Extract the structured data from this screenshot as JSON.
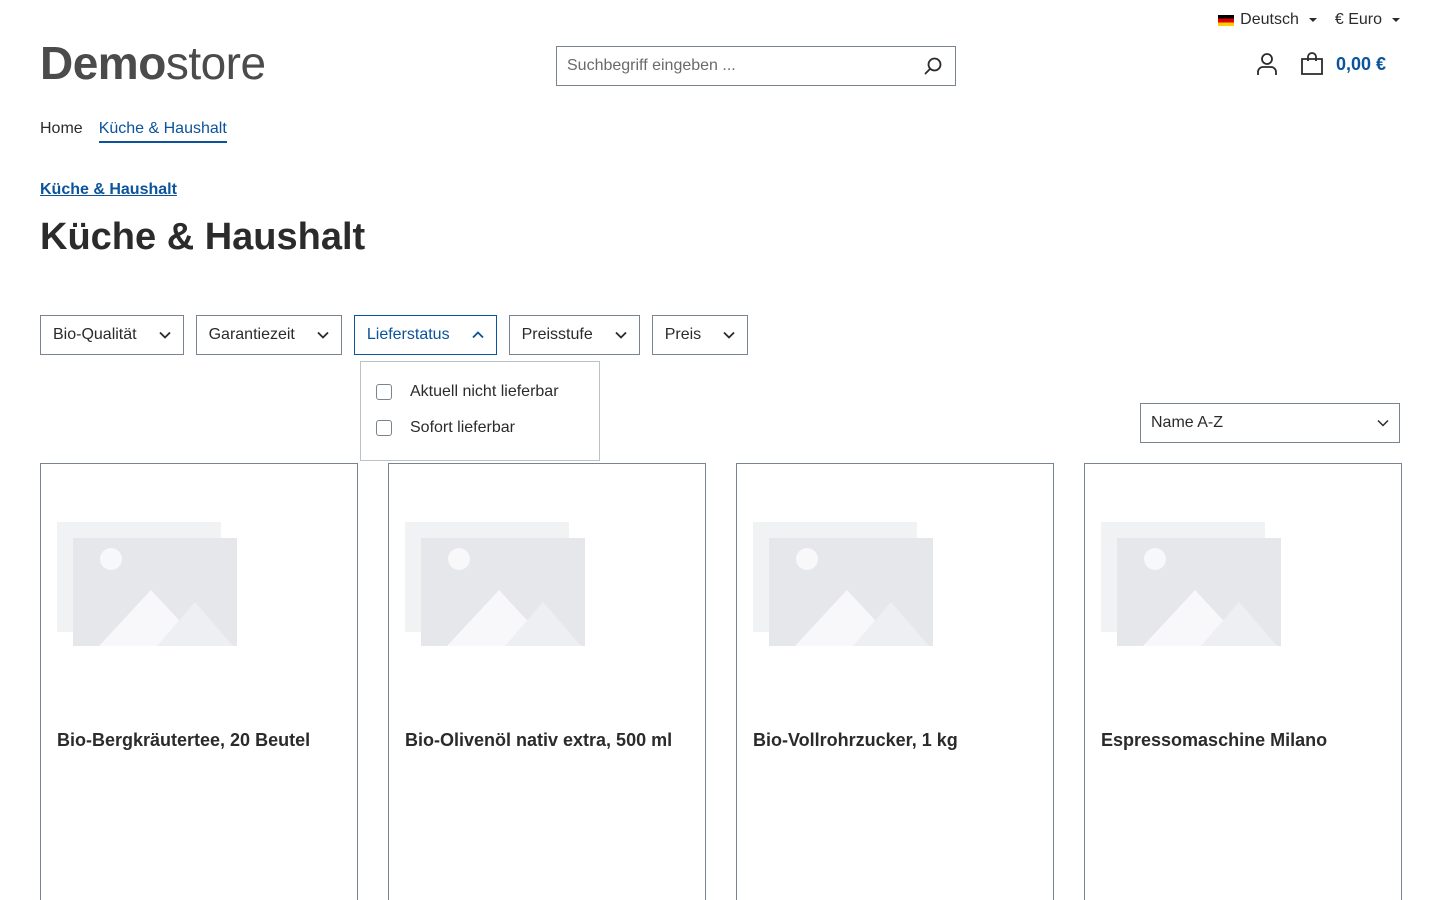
{
  "topbar": {
    "language": "Deutsch",
    "currency": "€ Euro"
  },
  "header": {
    "logo_bold": "Demo",
    "logo_light": "store",
    "search_placeholder": "Suchbegriff eingeben ...",
    "cart_total": "0,00 €"
  },
  "nav": {
    "items": [
      {
        "label": "Home"
      },
      {
        "label": "Küche & Haushalt"
      }
    ]
  },
  "category": {
    "link": "Küche & Haushalt",
    "title": "Küche & Haushalt"
  },
  "filters": {
    "items": [
      {
        "label": "Bio-Qualität"
      },
      {
        "label": "Garantiezeit"
      },
      {
        "label": "Lieferstatus"
      },
      {
        "label": "Preisstufe"
      },
      {
        "label": "Preis"
      }
    ],
    "dropdown_options": [
      {
        "label": "Aktuell nicht lieferbar"
      },
      {
        "label": "Sofort lieferbar"
      }
    ]
  },
  "sort": {
    "selected": "Name A-Z"
  },
  "products": [
    {
      "name": "Bio-Bergkräutertee, 20 Beutel"
    },
    {
      "name": "Bio-Olivenöl nativ extra, 500 ml"
    },
    {
      "name": "Bio-Vollrohrzucker, 1 kg"
    },
    {
      "name": "Espressomaschine Milano"
    }
  ],
  "colors": {
    "primary": "#0b539b",
    "text": "#2b2b2b",
    "border": "#798490",
    "placeholder_image": "#e6e7eb"
  }
}
